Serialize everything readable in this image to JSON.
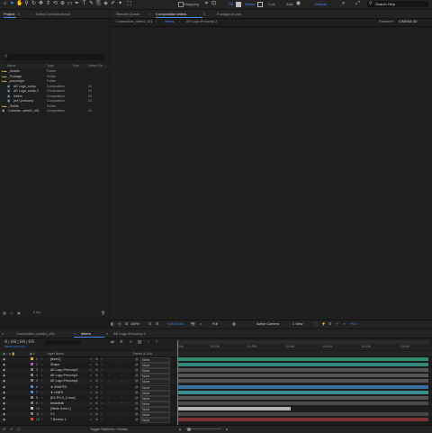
{
  "toolbar": {
    "snapping_label": "Snapping",
    "fill_label": "Fill",
    "stroke_label": "Stroke",
    "stroke_size": "1 px",
    "add_label": "Add:",
    "workspace": "Default",
    "search_placeholder": "Search Help"
  },
  "project_panel": {
    "tab_project": "Project",
    "tab_effect_controls": "Effect Controls linen2",
    "search_placeholder": "",
    "columns": [
      "Name",
      "Type",
      "Size",
      "Frame Ra"
    ],
    "rows": [
      {
        "name": "_Assets",
        "type": "Folder",
        "size": "",
        "indent": 0
      },
      {
        "name": "_Footage",
        "type": "Folder",
        "size": "",
        "indent": 0
      },
      {
        "name": "_precomps",
        "type": "Folder",
        "size": "",
        "indent": 0
      },
      {
        "name": "AE Logo_comp",
        "type": "Composition",
        "size": "24",
        "indent": 1
      },
      {
        "name": "AE Logo_comp 2",
        "type": "Composition",
        "size": "24",
        "indent": 1
      },
      {
        "name": "letters",
        "type": "Composition",
        "size": "24",
        "indent": 1
      },
      {
        "name": "pre7-precomp",
        "type": "Composition",
        "size": "24",
        "indent": 1
      },
      {
        "name": "_Solids",
        "type": "Folder",
        "size": "",
        "indent": 0
      },
      {
        "name": "Commer...week1_v01",
        "type": "Composition",
        "size": "24",
        "indent": 0
      }
    ],
    "bit_depth": "8 bpc"
  },
  "comp_panel": {
    "tabs": [
      "Render Queue",
      "Composition letters",
      "Footage (none)"
    ],
    "breadcrumbs": [
      "Commotion_week1_v01",
      "letters",
      "AE Logo-Precomp 2"
    ],
    "renderer_label": "Renderer:",
    "renderer_value": "CINEMA 4D",
    "zoom": "100%",
    "timecode": "0;00;00;00",
    "resolution": "Full",
    "camera": "Active Camera",
    "views": "1 View",
    "offset": "+0.0"
  },
  "timeline": {
    "tabs": [
      "Commotion_week1_v01",
      "letters",
      "AE Logo-Precomp 2"
    ],
    "timecode": "0;00;00;00",
    "fps_label": "00000 (29.97 fps)",
    "col_layer_name": "Layer Name",
    "col_parent": "Parent & Link",
    "ruler_labels": [
      "00s",
      "00:15f",
      "01:00f",
      "01:15f",
      "02:00f",
      "02:15f",
      "03:00f"
    ],
    "footer": "Toggle Switches / Modes",
    "layers": [
      {
        "num": "1",
        "name": "[linen2]",
        "label_color": "#c9b44b",
        "parent": "None",
        "bar_color": "#2f8a6e",
        "bar_start": 0.0,
        "bar_end": 1.0
      },
      {
        "num": "2",
        "name": "Shape",
        "label_color": "#9b5fbf",
        "parent": "None",
        "bar_color": "#35877c",
        "bar_start": 0.0,
        "bar_end": 1.0
      },
      {
        "num": "3",
        "name": "AE Logo-Precomp2",
        "label_color": "#7f7f7f",
        "parent": "None",
        "bar_color": "#555555",
        "bar_start": 0.0,
        "bar_end": 1.0
      },
      {
        "num": "4",
        "name": "AE Logo-Precomp1",
        "label_color": "#7f7f7f",
        "parent": "None",
        "bar_color": "#555555",
        "bar_start": 0.0,
        "bar_end": 1.0
      },
      {
        "num": "5",
        "name": "AE Logo-Precomp1",
        "label_color": "#7f7f7f",
        "parent": "None",
        "bar_color": "#555555",
        "bar_start": 0.0,
        "bar_end": 1.0
      },
      {
        "num": "6",
        "name": "★ SHAPES",
        "label_color": "#4a8ac9",
        "parent": "None",
        "bar_color": "#3a6f9e",
        "bar_start": 0.0,
        "bar_end": 1.0
      },
      {
        "num": "7",
        "name": "★ LINES",
        "label_color": "#4a8ac9",
        "parent": "None",
        "bar_color": "#3a8f8f",
        "bar_start": 0.0,
        "bar_end": 1.0
      },
      {
        "num": "8",
        "name": "[EX-PO-9_2.mov]",
        "label_color": "#7f7f7f",
        "parent": "None",
        "bar_color": "#555555",
        "bar_start": 0.0,
        "bar_end": 1.0
      },
      {
        "num": "9",
        "name": "beachball",
        "label_color": "#7f7f7f",
        "parent": "None",
        "bar_color": "#4a4a4a",
        "bar_start": 0.0,
        "bar_end": 1.0
      },
      {
        "num": "10",
        "name": "[White Solid 1]",
        "label_color": "#c2c2c2",
        "parent": "None",
        "bar_color": "#b3b3b3",
        "bar_start": 0.0,
        "bar_end": 0.45
      },
      {
        "num": "11",
        "name": "3.1",
        "label_color": "#7f7f7f",
        "parent": "None",
        "bar_color": "#454545",
        "bar_start": 0.0,
        "bar_end": 1.0
      },
      {
        "num": "12",
        "name": "T Bezenz 1",
        "label_color": "#c94b4b",
        "parent": "None",
        "bar_color": "#7a3434",
        "bar_start": 0.0,
        "bar_end": 1.0
      }
    ]
  },
  "colors": {
    "accent": "#3d8df5",
    "timecode": "#e8a33a"
  }
}
